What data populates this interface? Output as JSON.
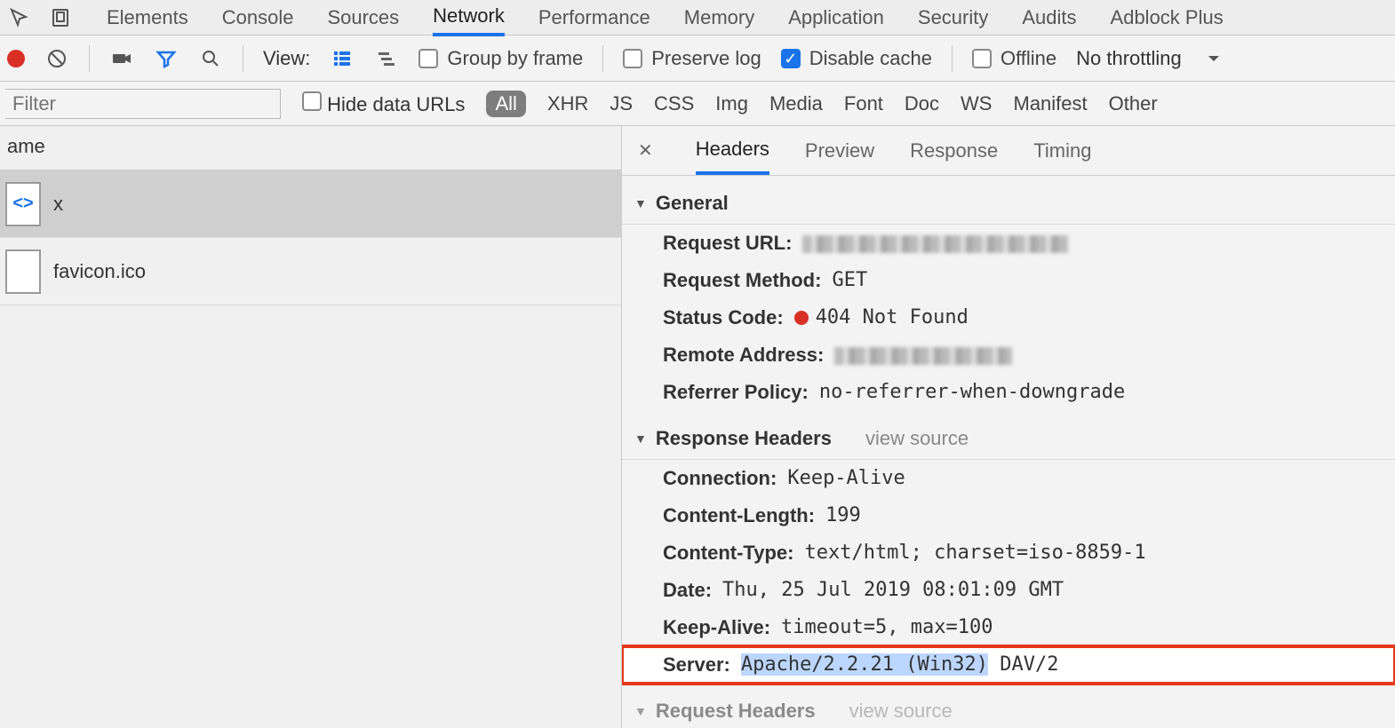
{
  "mainTabs": {
    "items": [
      "Elements",
      "Console",
      "Sources",
      "Network",
      "Performance",
      "Memory",
      "Application",
      "Security",
      "Audits",
      "Adblock Plus"
    ],
    "active": "Network"
  },
  "toolbar": {
    "viewLabel": "View:",
    "groupByFrame": "Group by frame",
    "preserveLog": "Preserve log",
    "disableCache": "Disable cache",
    "offline": "Offline",
    "throttling": "No throttling"
  },
  "filterBar": {
    "placeholder": "Filter",
    "hideDataUrls": "Hide data URLs",
    "types": [
      "All",
      "XHR",
      "JS",
      "CSS",
      "Img",
      "Media",
      "Font",
      "Doc",
      "WS",
      "Manifest",
      "Other"
    ],
    "active": "All"
  },
  "leftPane": {
    "columnHeader": "ame",
    "rows": [
      {
        "name": "x",
        "iconGlyph": "<>",
        "selected": true
      },
      {
        "name": "favicon.ico",
        "iconGlyph": "",
        "selected": false
      }
    ]
  },
  "detailTabs": {
    "items": [
      "Headers",
      "Preview",
      "Response",
      "Timing"
    ],
    "active": "Headers"
  },
  "general": {
    "title": "General",
    "requestUrlLabel": "Request URL",
    "requestUrlRedacted": true,
    "requestMethodLabel": "Request Method",
    "requestMethod": "GET",
    "statusCodeLabel": "Status Code",
    "statusCode": "404 Not Found",
    "remoteAddressLabel": "Remote Address",
    "remoteAddressRedacted": true,
    "referrerPolicyLabel": "Referrer Policy",
    "referrerPolicy": "no-referrer-when-downgrade"
  },
  "responseHeaders": {
    "title": "Response Headers",
    "viewSource": "view source",
    "headers": [
      {
        "k": "Connection",
        "v": "Keep-Alive"
      },
      {
        "k": "Content-Length",
        "v": "199"
      },
      {
        "k": "Content-Type",
        "v": "text/html; charset=iso-8859-1"
      },
      {
        "k": "Date",
        "v": "Thu, 25 Jul 2019 08:01:09 GMT"
      },
      {
        "k": "Keep-Alive",
        "v": "timeout=5, max=100"
      },
      {
        "k": "Server",
        "v": "Apache/2.2.21 (Win32) DAV/2",
        "highlight": true,
        "selected": "Apache/2.2.21 (Win32)"
      }
    ]
  },
  "requestHeaders": {
    "title": "Request Headers",
    "viewSource": "view source"
  }
}
